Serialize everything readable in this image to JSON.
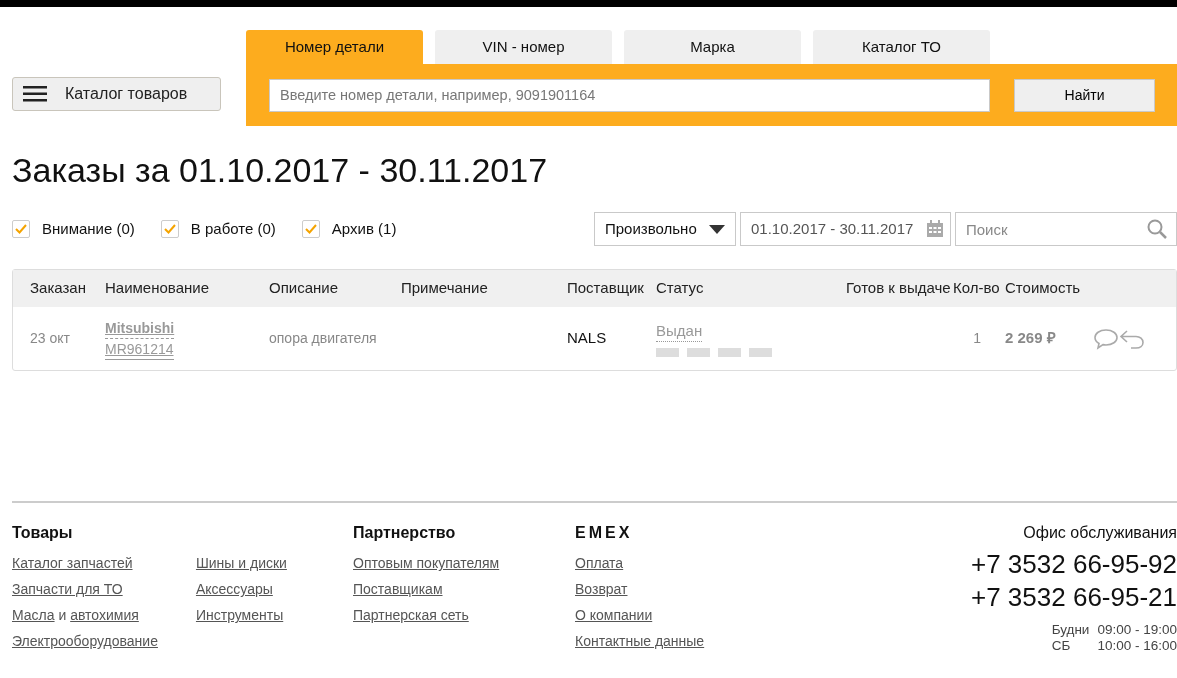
{
  "catalog_button": {
    "label": "Каталог товаров"
  },
  "search_tabs": [
    {
      "label": "Номер детали",
      "selected": true
    },
    {
      "label": "VIN - номер",
      "selected": false
    },
    {
      "label": "Марка",
      "selected": false
    },
    {
      "label": "Каталог ТО",
      "selected": false
    }
  ],
  "part_search": {
    "placeholder": "Введите номер детали, например, 9091901164",
    "button": "Найти"
  },
  "page_title": "Заказы за 01.10.2017 - 30.11.2017",
  "filters": [
    {
      "label": "Внимание (0)",
      "checked": true
    },
    {
      "label": "В работе (0)",
      "checked": true
    },
    {
      "label": "Архив (1)",
      "checked": true
    }
  ],
  "period_select": {
    "value": "Произвольно"
  },
  "date_range": {
    "value": "01.10.2017 - 30.11.2017"
  },
  "search": {
    "placeholder": "Поиск"
  },
  "table": {
    "columns": [
      "Заказан",
      "Наименование",
      "Описание",
      "Примечание",
      "Поставщик",
      "Статус",
      "Готов к выдаче",
      "Кол-во",
      "Стоимость"
    ],
    "rows": [
      {
        "ordered": "23 окт",
        "brand": "Mitsubishi",
        "part_number": "MR961214",
        "description": "опора двигателя",
        "supplier": "NALS",
        "status": "Выдан",
        "quantity": "1",
        "price": "2 269 ₽"
      }
    ]
  },
  "footer": {
    "sections": [
      {
        "title": "Товары",
        "columns": [
          [
            {
              "label": "Каталог запчастей"
            },
            {
              "label": "Запчасти для ТО"
            },
            {
              "links": [
                "Масла",
                "автохимия"
              ],
              "joiner": "и"
            },
            {
              "label": "Электрооборудование"
            }
          ],
          [
            {
              "label": "Шины и диски"
            },
            {
              "label": "Аксессуары"
            },
            {
              "label": "Инструменты"
            }
          ]
        ]
      },
      {
        "title": "Партнерство",
        "columns": [
          [
            {
              "label": "Оптовым покупателям"
            },
            {
              "label": "Поставщикам"
            },
            {
              "label": "Партнерская сеть"
            }
          ]
        ]
      },
      {
        "title": "EMEX",
        "columns": [
          [
            {
              "label": "Оплата"
            },
            {
              "label": "Возврат"
            },
            {
              "label": "О компании"
            },
            {
              "label": "Контактные данные"
            }
          ]
        ]
      }
    ],
    "office": {
      "title": "Офис обслуживания",
      "phones": [
        "+7 3532 66-95-92",
        "+7 3532 66-95-21"
      ],
      "hours": [
        {
          "days": "Будни",
          "time": "09:00 - 19:00"
        },
        {
          "days": "СБ",
          "time": "10:00 - 16:00"
        }
      ]
    }
  }
}
